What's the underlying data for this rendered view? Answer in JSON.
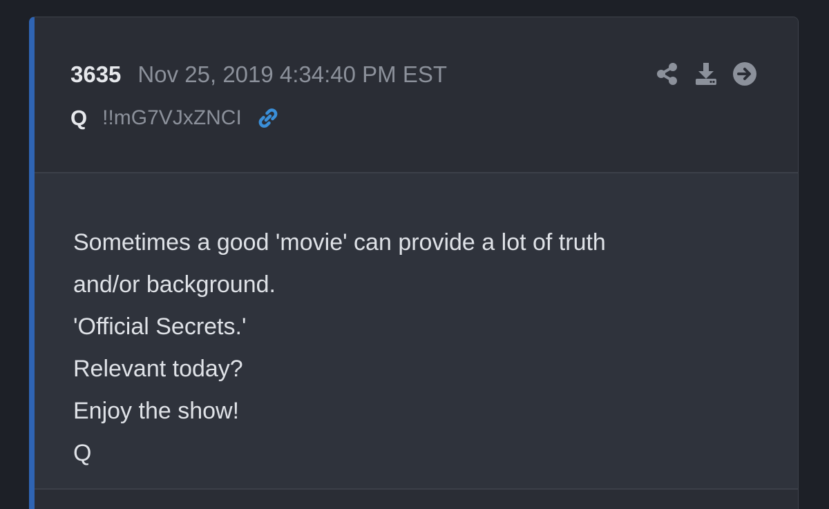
{
  "post": {
    "number": "3635",
    "date": "Nov 25, 2019 4:34:40 PM EST",
    "author": "Q",
    "tripcode": "!!mG7VJxZNCI",
    "lines": [
      "Sometimes a good 'movie' can provide a lot of truth",
      "and/or background.",
      "'Official Secrets.'",
      "Relevant today?",
      "Enjoy the show!",
      "Q"
    ]
  },
  "icons": {
    "link": "link-icon",
    "share": "share-icon",
    "download": "download-icon",
    "next": "arrow-right-circle-icon"
  },
  "colors": {
    "accent": "#2f64b3",
    "link": "#3a8fd9",
    "muted_icon": "#8c919b"
  }
}
